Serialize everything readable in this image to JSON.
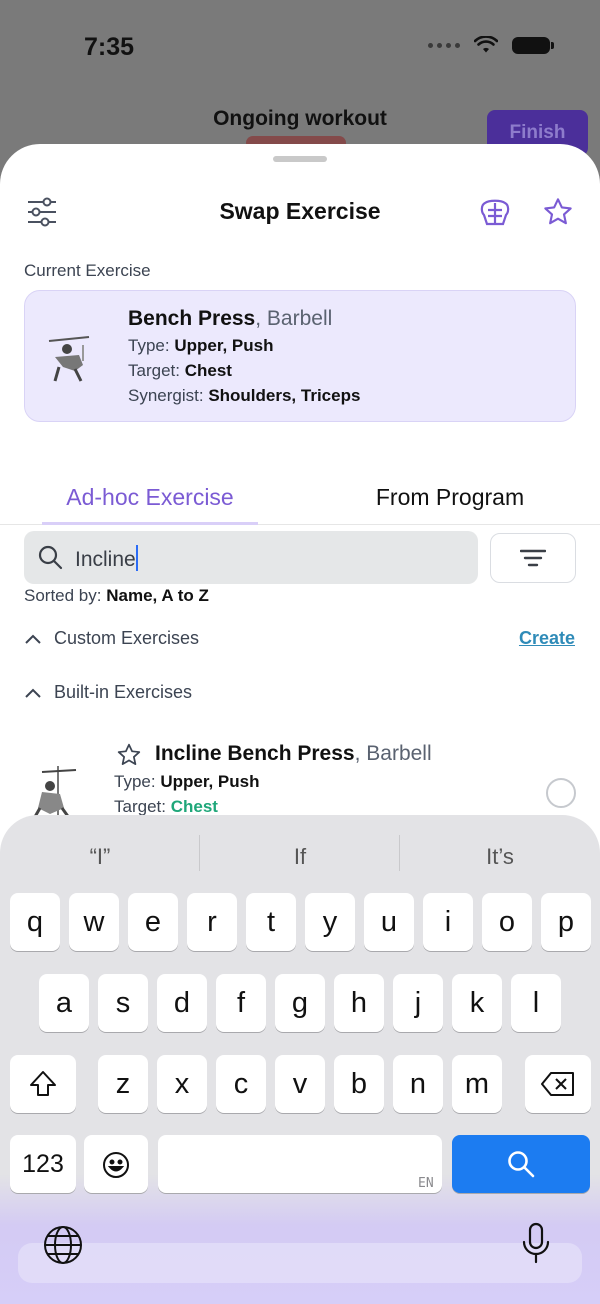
{
  "status_bar": {
    "time": "7:35"
  },
  "background_screen": {
    "title": "Ongoing workout",
    "finish_label": "Finish"
  },
  "sheet": {
    "title": "Swap Exercise",
    "current_label": "Current Exercise",
    "current_exercise": {
      "name": "Bench Press",
      "equipment": ", Barbell",
      "type_label": "Type: ",
      "type_value": "Upper, Push",
      "target_label": "Target: ",
      "target_value": "Chest",
      "synergist_label": "Synergist: ",
      "synergist_value": "Shoulders, Triceps"
    },
    "tabs": [
      "Ad-hoc Exercise",
      "From Program"
    ],
    "active_tab": 0,
    "search": {
      "value": "Incline"
    },
    "sorted_label": "Sorted by: ",
    "sorted_value": "Name, A to Z",
    "custom_section": "Custom Exercises",
    "create_label": "Create",
    "builtin_section": "Built-in Exercises",
    "results": [
      {
        "name": "Incline Bench Press",
        "equipment": ", Barbell",
        "type_label": "Type: ",
        "type_value": "Upper, Push",
        "target_label": "Target: ",
        "target_value": "Chest"
      }
    ]
  },
  "keyboard": {
    "suggestions": [
      "“I”",
      "If",
      "It’s"
    ],
    "row1": [
      "q",
      "w",
      "e",
      "r",
      "t",
      "y",
      "u",
      "i",
      "o",
      "p"
    ],
    "row2": [
      "a",
      "s",
      "d",
      "f",
      "g",
      "h",
      "j",
      "k",
      "l"
    ],
    "row3": [
      "z",
      "x",
      "c",
      "v",
      "b",
      "n",
      "m"
    ],
    "numbers_label": "123",
    "language_label": "EN"
  },
  "colors": {
    "accent": "#7b5bd4",
    "card_bg": "#ece9fd",
    "target_green": "#1fa77a",
    "key_blue": "#1c7cf1"
  }
}
